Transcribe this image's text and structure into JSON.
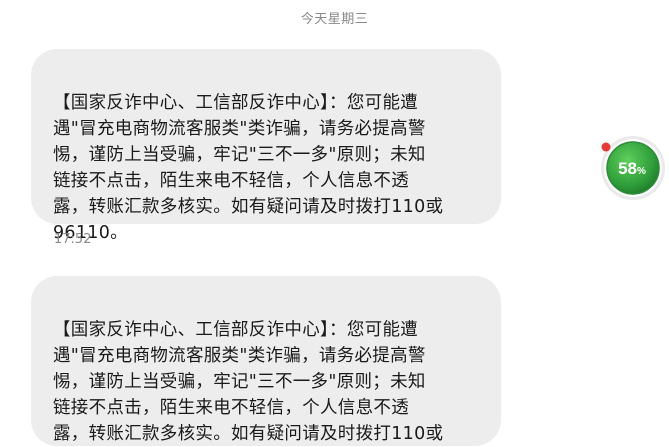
{
  "header": {
    "day_label": "今天星期三"
  },
  "messages": [
    {
      "text": "【国家反诈中心、工信部反诈中心】：您可能遭\n遇\"冒充电商物流客服类\"类诈骗，请务必提高警\n惕，谨防上当受骗，牢记\"三不一多\"原则；未知\n链接不点击，陌生来电不轻信，个人信息不透\n露，转账汇款多核实。如有疑问请及时拨打110或\n96110。",
      "time": "17:52"
    },
    {
      "text": "【国家反诈中心、工信部反诈中心】：您可能遭\n遇\"冒充电商物流客服类\"类诈骗，请务必提高警\n惕，谨防上当受骗，牢记\"三不一多\"原则；未知\n链接不点击，陌生来电不轻信，个人信息不透\n露，转账汇款多核实。如有疑问请及时拨打110或"
    }
  ],
  "floating_widget": {
    "value": "58",
    "unit": "%",
    "level": 0.58,
    "icon": "memory-boost-ball-icon",
    "colors": {
      "ring": "#2e8b3a",
      "fill": "#36a843",
      "dot": "#e53935"
    }
  }
}
